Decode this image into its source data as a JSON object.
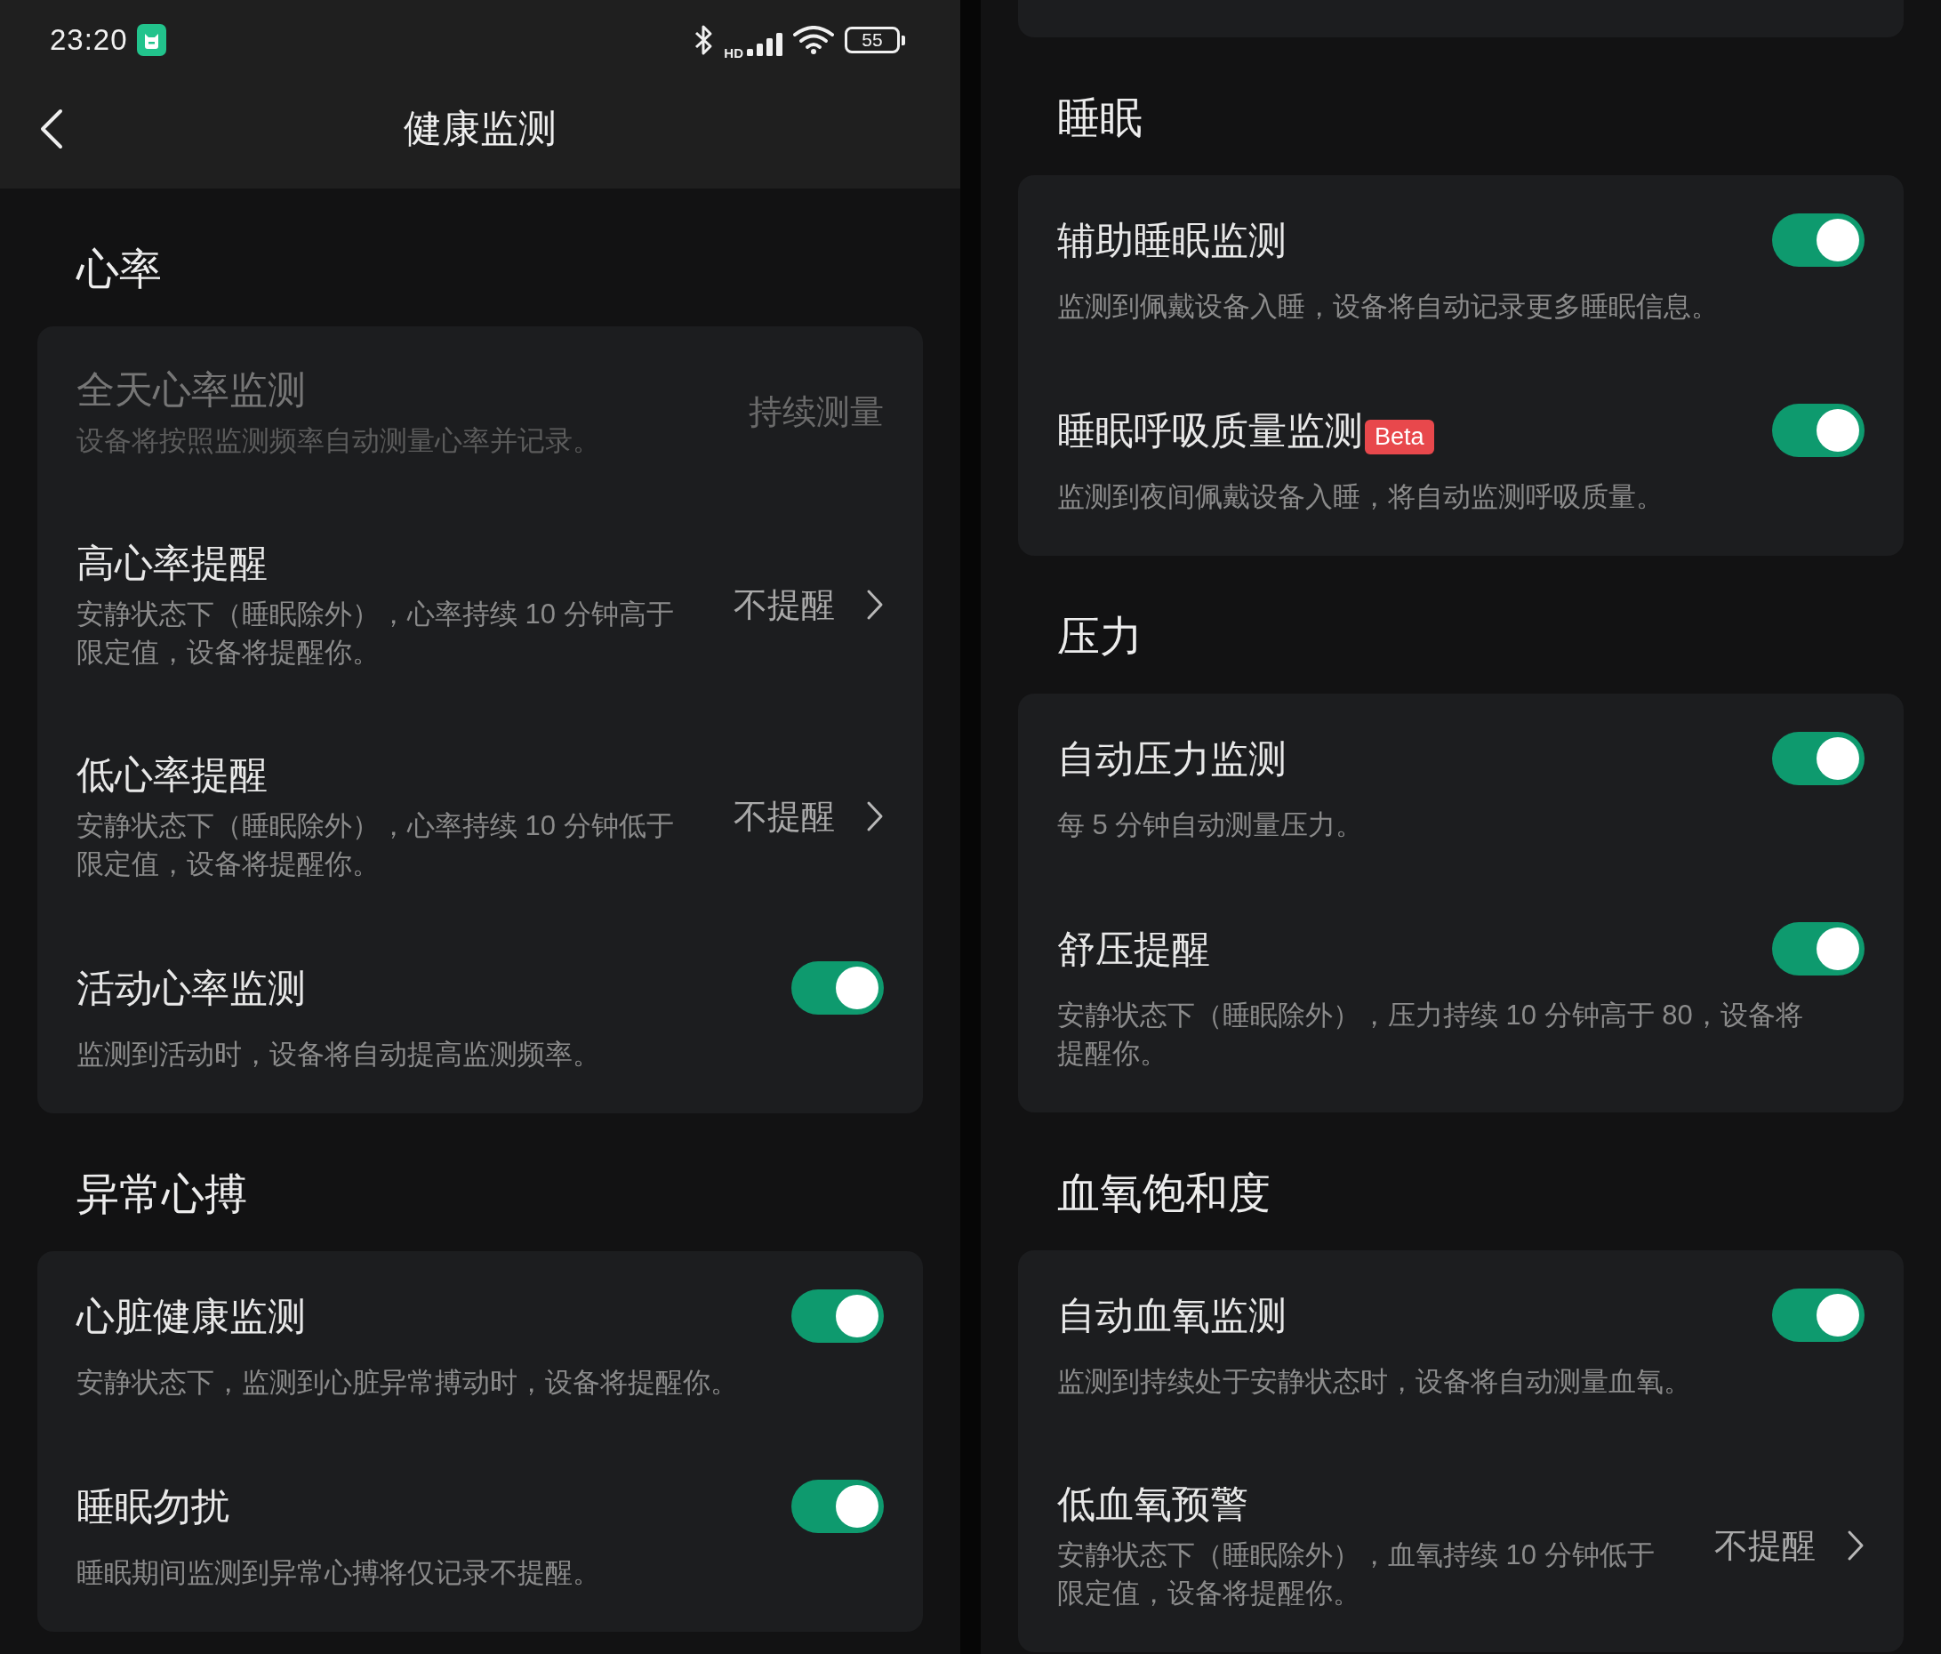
{
  "left_screen": {
    "status_bar": {
      "time": "23:20",
      "network_type": "HD",
      "battery": "55"
    },
    "header": {
      "title": "健康监测"
    },
    "sections": [
      {
        "title": "心率",
        "items": [
          {
            "kind": "value",
            "title": "全天心率监测",
            "description": "设备将按照监测频率自动测量心率并记录。",
            "value": "持续测量",
            "disabled": true
          },
          {
            "kind": "link",
            "title": "高心率提醒",
            "description": "安静状态下（睡眠除外），心率持续 10 分钟高于限定值，设备将提醒你。",
            "value": "不提醒",
            "disabled": false
          },
          {
            "kind": "link",
            "title": "低心率提醒",
            "description": "安静状态下（睡眠除外），心率持续 10 分钟低于限定值，设备将提醒你。",
            "value": "不提醒",
            "disabled": false
          },
          {
            "kind": "toggle",
            "title": "活动心率监测",
            "description": "监测到活动时，设备将自动提高监测频率。",
            "on": true,
            "disabled": false
          }
        ]
      },
      {
        "title": "异常心搏",
        "items": [
          {
            "kind": "toggle",
            "title": "心脏健康监测",
            "description": "安静状态下，监测到心脏异常搏动时，设备将提醒你。",
            "on": true,
            "disabled": false
          },
          {
            "kind": "toggle",
            "title": "睡眠勿扰",
            "description": "睡眠期间监测到异常心搏将仅记录不提醒。",
            "on": true,
            "disabled": false
          }
        ]
      }
    ]
  },
  "right_screen": {
    "sections": [
      {
        "title": "睡眠",
        "items": [
          {
            "kind": "toggle",
            "title": "辅助睡眠监测",
            "description": "监测到佩戴设备入睡，设备将自动记录更多睡眠信息。",
            "on": true,
            "disabled": false
          },
          {
            "kind": "toggle",
            "title": "睡眠呼吸质量监测",
            "badge": "Beta",
            "description": "监测到夜间佩戴设备入睡，将自动监测呼吸质量。",
            "on": true,
            "disabled": false
          }
        ]
      },
      {
        "title": "压力",
        "items": [
          {
            "kind": "toggle",
            "title": "自动压力监测",
            "description": "每 5 分钟自动测量压力。",
            "on": true,
            "disabled": false
          },
          {
            "kind": "toggle",
            "title": "舒压提醒",
            "description": "安静状态下（睡眠除外），压力持续 10 分钟高于 80，设备将提醒你。",
            "on": true,
            "disabled": false
          }
        ]
      },
      {
        "title": "血氧饱和度",
        "items": [
          {
            "kind": "toggle",
            "title": "自动血氧监测",
            "description": "监测到持续处于安静状态时，设备将自动测量血氧。",
            "on": true,
            "disabled": false
          },
          {
            "kind": "link",
            "title": "低血氧预警",
            "description": "安静状态下（睡眠除外），血氧持续 10 分钟低于限定值，设备将提醒你。",
            "value": "不提醒",
            "disabled": false
          }
        ]
      }
    ]
  }
}
